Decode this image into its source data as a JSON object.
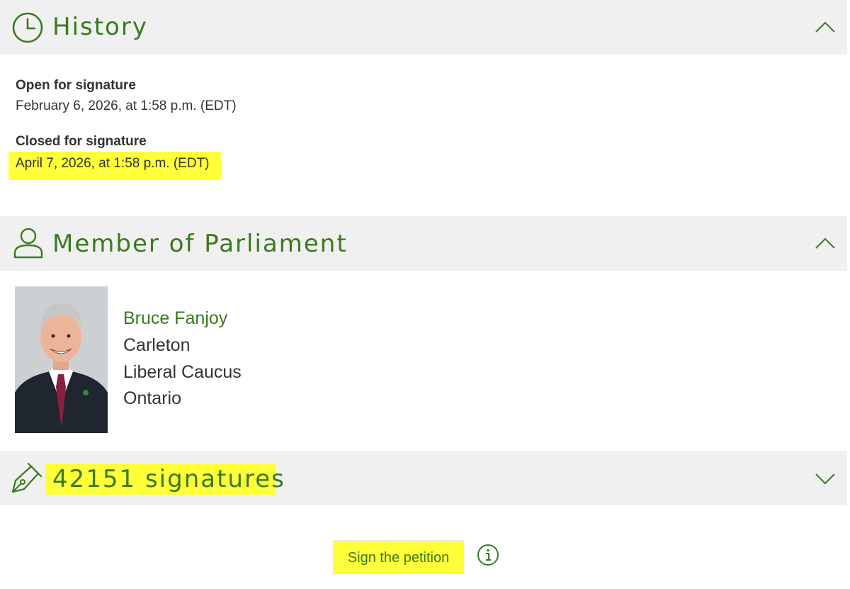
{
  "history": {
    "title": "History",
    "icon": "clock-icon",
    "open_label": "Open for signature",
    "open_value": "February 6, 2026, at 1:58 p.m. (EDT)",
    "closed_label": "Closed for signature",
    "closed_value": "April 7, 2026, at 1:58 p.m. (EDT)"
  },
  "mp": {
    "title": "Member of Parliament",
    "icon": "person-icon",
    "name": "Bruce Fanjoy",
    "riding": "Carleton",
    "caucus": "Liberal Caucus",
    "province": "Ontario"
  },
  "signatures": {
    "title": "42151 signatures",
    "icon": "pen-icon"
  },
  "actions": {
    "sign_label": "Sign the petition",
    "info_icon": "info-icon"
  },
  "colors": {
    "accent": "#3a7a1f",
    "header_bg": "#f0f0f0",
    "highlight": "#ffff3a",
    "text": "#333333"
  }
}
